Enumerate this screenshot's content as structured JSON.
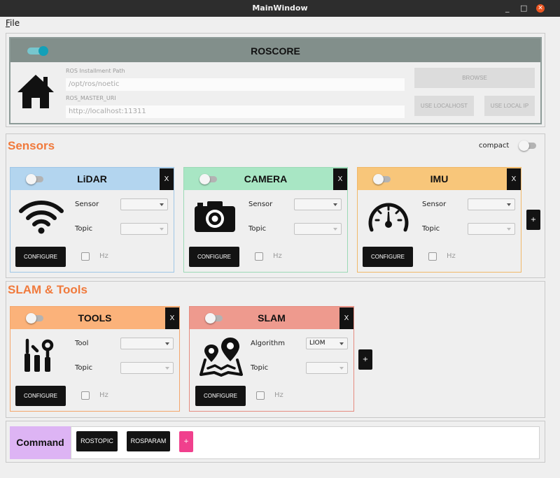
{
  "window": {
    "title": "MainWindow",
    "minimize": "_",
    "maximize": "□",
    "close": "✕"
  },
  "menu": {
    "file": "ile",
    "file_mnemonic": "F"
  },
  "roscore": {
    "title": "ROSCORE",
    "enabled": true,
    "path_label": "ROS Installment Path",
    "path_value": "/opt/ros/noetic",
    "uri_label": "ROS_MASTER_URI",
    "uri_value": "http://localhost:11311",
    "browse": "BROWSE",
    "use_localhost": "USE LOCALHOST",
    "use_local_ip": "USE LOCAL IP",
    "icon": "home-icon"
  },
  "sensors": {
    "title": "Sensors",
    "compact_label": "compact",
    "add": "+",
    "cards": [
      {
        "title": "LiDAR",
        "color": "#b3d5ef",
        "border": "#9fc6e6",
        "icon": "wifi-icon",
        "select_label": "Sensor",
        "topic_label": "Topic",
        "configure": "CONFIGURE",
        "hz": "Hz",
        "close": "X"
      },
      {
        "title": "CAMERA",
        "color": "#a8e6c4",
        "border": "#9cd9b6",
        "icon": "camera-icon",
        "select_label": "Sensor",
        "topic_label": "Topic",
        "configure": "CONFIGURE",
        "hz": "Hz",
        "close": "X"
      },
      {
        "title": "IMU",
        "color": "#f8c67a",
        "border": "#f0b869",
        "icon": "gauge-icon",
        "select_label": "Sensor",
        "topic_label": "Topic",
        "configure": "CONFIGURE",
        "hz": "Hz",
        "close": "X"
      }
    ]
  },
  "slam_tools": {
    "title": "SLAM & Tools",
    "add": "+",
    "cards": [
      {
        "title": "TOOLS",
        "color": "#fbb27a",
        "border": "#f4a66b",
        "icon": "tools-icon",
        "select_label": "Tool",
        "select_value": "",
        "topic_label": "Topic",
        "configure": "CONFIGURE",
        "hz": "Hz",
        "close": "X"
      },
      {
        "title": "SLAM",
        "color": "#ee9a8e",
        "border": "#e58c80",
        "icon": "map-icon",
        "select_label": "Algorithm",
        "select_value": "LIOM",
        "topic_label": "Topic",
        "configure": "CONFIGURE",
        "hz": "Hz",
        "close": "X"
      }
    ]
  },
  "command": {
    "label": "Command",
    "rostopic": "ROSTOPIC",
    "rosparam": "ROSPARAM",
    "add": "+"
  }
}
